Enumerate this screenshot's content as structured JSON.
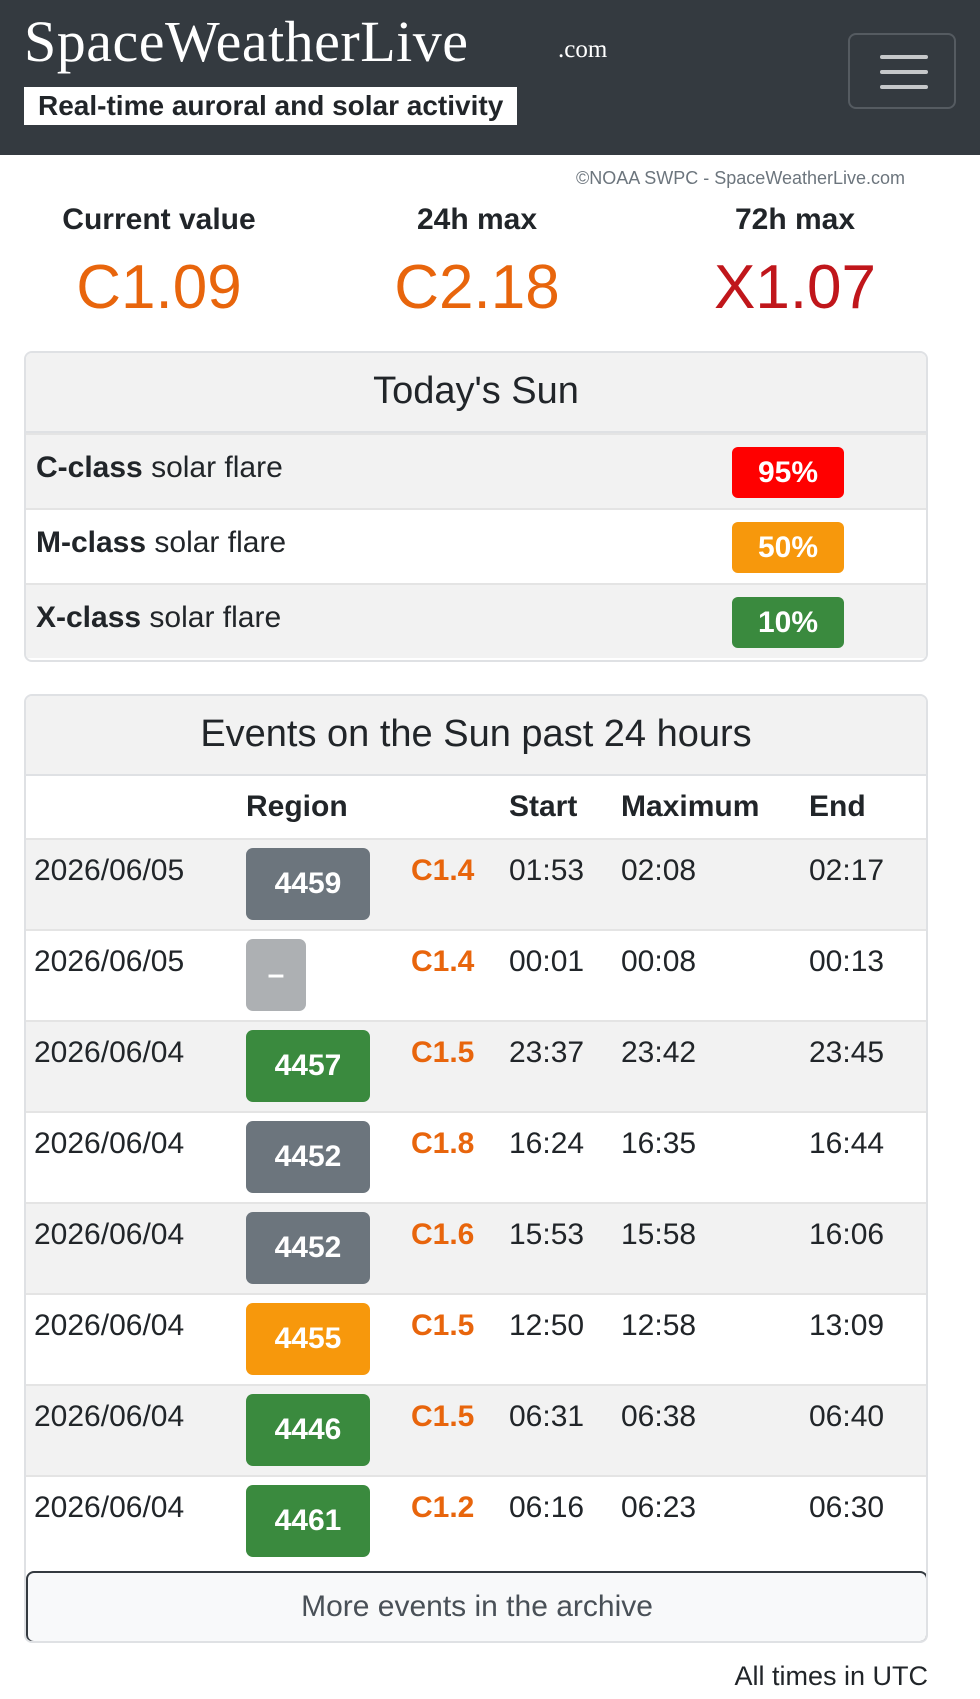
{
  "header": {
    "brand": "SpaceWeatherLive",
    "brand_suffix": ".com",
    "tagline": "Real-time auroral and solar activity",
    "menu_icon": "hamburger-menu-icon"
  },
  "xray": {
    "credit": "©NOAA SWPC - SpaceWeatherLive.com",
    "stats": [
      {
        "label": "Current value",
        "value": "C1.09",
        "color": "#e8650c"
      },
      {
        "label": "24h max",
        "value": "C2.18",
        "color": "#e8650c"
      },
      {
        "label": "72h max",
        "value": "X1.07",
        "color": "#c0161b"
      }
    ]
  },
  "todays_sun": {
    "title": "Today's Sun",
    "rows": [
      {
        "class_label": "C-class",
        "suffix": " solar flare",
        "probability": "95%",
        "color": "#ff0000"
      },
      {
        "class_label": "M-class",
        "suffix": " solar flare",
        "probability": "50%",
        "color": "#f7980c"
      },
      {
        "class_label": "X-class",
        "suffix": " solar flare",
        "probability": "10%",
        "color": "#3a8a3e"
      }
    ]
  },
  "events": {
    "title": "Events on the Sun past 24 hours",
    "headers": {
      "region": "Region",
      "start": "Start",
      "maximum": "Maximum",
      "end": "End"
    },
    "rows": [
      {
        "date": "2026/06/05",
        "region": "4459",
        "region_color": "#6c757d",
        "class": "C1.4",
        "start": "01:53",
        "max": "02:08",
        "end": "02:17"
      },
      {
        "date": "2026/06/05",
        "region": "–",
        "region_color": "#adb0b3",
        "class": "C1.4",
        "start": "00:01",
        "max": "00:08",
        "end": "00:13"
      },
      {
        "date": "2026/06/04",
        "region": "4457",
        "region_color": "#3a8a3e",
        "class": "C1.5",
        "start": "23:37",
        "max": "23:42",
        "end": "23:45"
      },
      {
        "date": "2026/06/04",
        "region": "4452",
        "region_color": "#6c757d",
        "class": "C1.8",
        "start": "16:24",
        "max": "16:35",
        "end": "16:44"
      },
      {
        "date": "2026/06/04",
        "region": "4452",
        "region_color": "#6c757d",
        "class": "C1.6",
        "start": "15:53",
        "max": "15:58",
        "end": "16:06"
      },
      {
        "date": "2026/06/04",
        "region": "4455",
        "region_color": "#f7980c",
        "class": "C1.5",
        "start": "12:50",
        "max": "12:58",
        "end": "13:09"
      },
      {
        "date": "2026/06/04",
        "region": "4446",
        "region_color": "#3a8a3e",
        "class": "C1.5",
        "start": "06:31",
        "max": "06:38",
        "end": "06:40"
      },
      {
        "date": "2026/06/04",
        "region": "4461",
        "region_color": "#3a8a3e",
        "class": "C1.2",
        "start": "06:16",
        "max": "06:23",
        "end": "06:30"
      }
    ],
    "archive_button": "More events in the archive",
    "footer_note": "All times in UTC"
  }
}
